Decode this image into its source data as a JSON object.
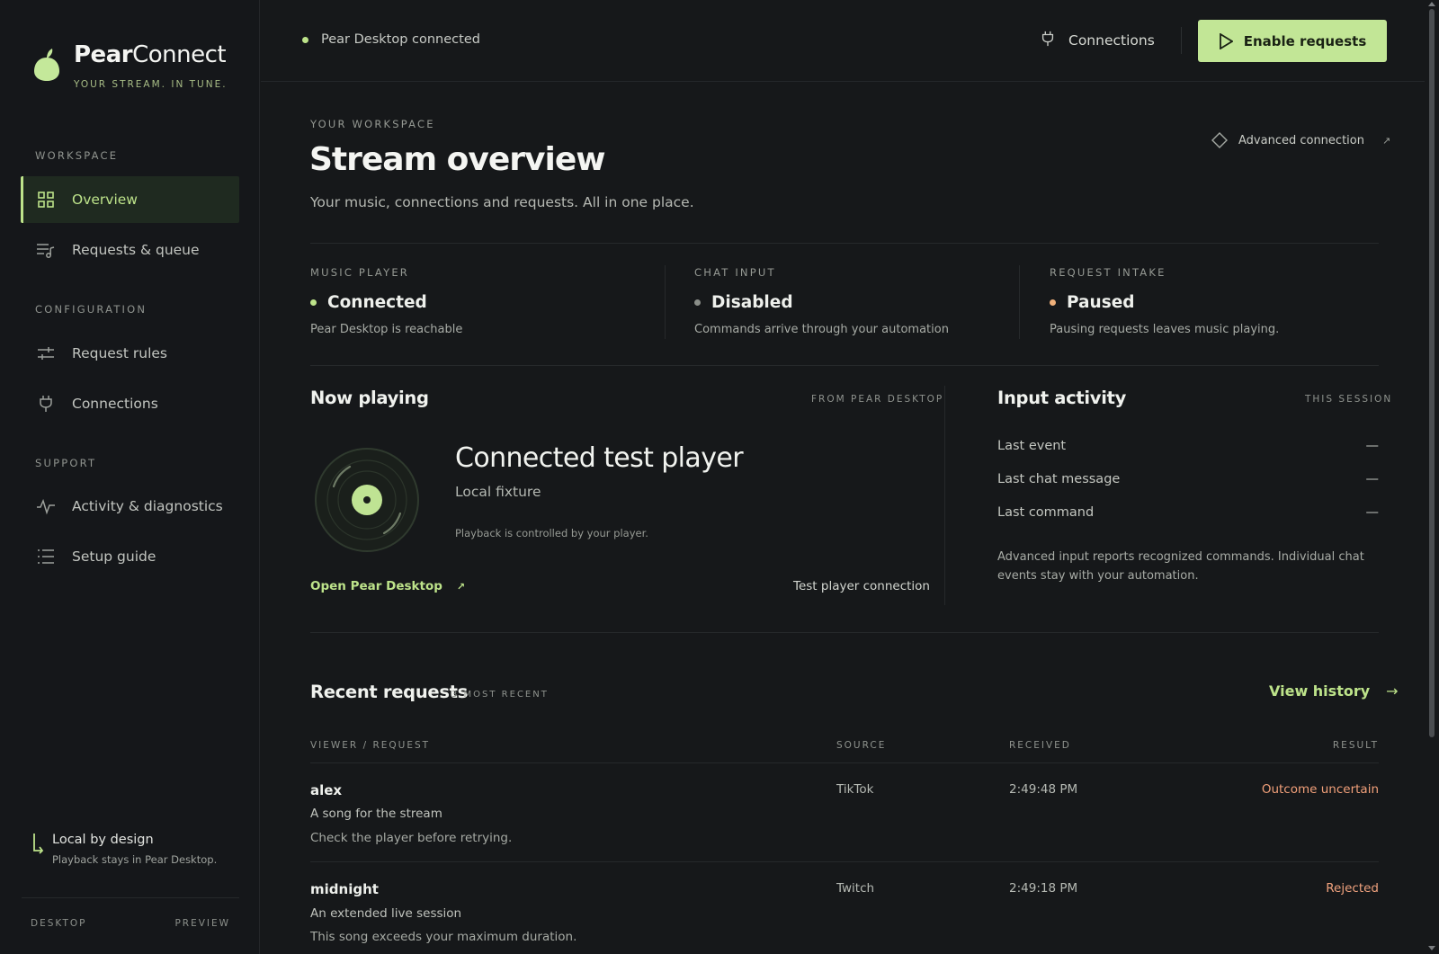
{
  "brand": {
    "name_bold": "Pear",
    "name_light": "Connect",
    "tagline": "YOUR STREAM. IN TUNE."
  },
  "sidebar": {
    "sections": {
      "workspace": "WORKSPACE",
      "configuration": "CONFIGURATION",
      "support": "SUPPORT"
    },
    "items": {
      "overview": "Overview",
      "requests_queue": "Requests & queue",
      "request_rules": "Request rules",
      "connections": "Connections",
      "activity": "Activity & diagnostics",
      "setup_guide": "Setup guide"
    },
    "local_title": "Local by design",
    "local_sub": "Playback stays in Pear Desktop.",
    "footer_left": "DESKTOP",
    "footer_right": "PREVIEW"
  },
  "topbar": {
    "status": "Pear Desktop connected",
    "connections": "Connections",
    "enable_button": "Enable requests"
  },
  "header": {
    "eyebrow": "YOUR WORKSPACE",
    "title": "Stream overview",
    "subtitle": "Your music, connections and requests. All in one place.",
    "advanced_connection": "Advanced connection"
  },
  "stats": [
    {
      "label": "MUSIC PLAYER",
      "value": "Connected",
      "desc": "Pear Desktop is reachable",
      "color": "#bde38a"
    },
    {
      "label": "CHAT INPUT",
      "value": "Disabled",
      "desc": "Commands arrive through your automation",
      "color": "#8a8e89"
    },
    {
      "label": "REQUEST INTAKE",
      "value": "Paused",
      "desc": "Pausing requests leaves music playing.",
      "color": "#f0b07a"
    }
  ],
  "now_playing": {
    "title": "Now playing",
    "source": "FROM PEAR DESKTOP",
    "track": "Connected test player",
    "artist": "Local fixture",
    "note": "Playback is controlled by your player.",
    "open_link": "Open Pear Desktop",
    "test_link": "Test player connection"
  },
  "input_activity": {
    "title": "Input activity",
    "scope": "THIS SESSION",
    "rows": [
      {
        "label": "Last event",
        "value": "—"
      },
      {
        "label": "Last chat message",
        "value": "—"
      },
      {
        "label": "Last command",
        "value": "—"
      }
    ],
    "note": "Advanced input reports recognized commands. Individual chat events stay with your automation."
  },
  "recent": {
    "title": "Recent requests",
    "count": "3 MOST RECENT",
    "view_history": "View history",
    "columns": [
      "VIEWER / REQUEST",
      "SOURCE",
      "RECEIVED",
      "RESULT"
    ],
    "rows": [
      {
        "viewer": "alex",
        "request": "A song for the stream",
        "note": "Check the player before retrying.",
        "source": "TikTok",
        "received": "2:49:48 PM",
        "result": "Outcome uncertain",
        "result_color": "#f2a07a"
      },
      {
        "viewer": "midnight",
        "request": "An extended live session",
        "note": "This song exceeds your maximum duration.",
        "source": "Twitch",
        "received": "2:49:18 PM",
        "result": "Rejected",
        "result_color": "#f0a27e"
      }
    ]
  },
  "colors": {
    "accent": "#bde38a",
    "button_bg": "#c2e696",
    "background": "#16181a"
  }
}
